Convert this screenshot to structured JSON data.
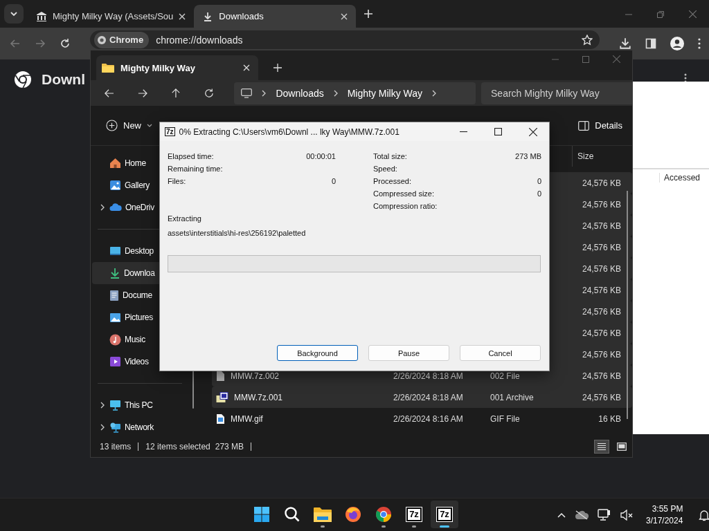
{
  "browser": {
    "tabs": [
      {
        "title": "Mighty Milky Way (Assets/Sou",
        "selected": false,
        "kind": "page"
      },
      {
        "title": "Downloads",
        "selected": true,
        "kind": "download"
      }
    ],
    "chip": "Chrome",
    "url": "chrome://downloads",
    "page_heading": "Downl"
  },
  "background_window": {
    "column_header": "Accessed"
  },
  "explorer": {
    "tab_title": "Mighty Milky Way",
    "breadcrumb": [
      "Downloads",
      "Mighty Milky Way"
    ],
    "search": {
      "placeholder": "Search Mighty Milky Way"
    },
    "new_button": "New",
    "details_button": "Details",
    "sidebar": [
      [
        {
          "label": "Home",
          "kind": "home",
          "selected": false,
          "collapsed": false
        },
        {
          "label": "Gallery",
          "kind": "gallery",
          "selected": false,
          "collapsed": false
        },
        {
          "label": "OneDriv",
          "kind": "cloud",
          "selected": false,
          "collapsed": true
        }
      ],
      [
        {
          "label": "Desktop",
          "kind": "desktop",
          "selected": false,
          "collapsed": false
        },
        {
          "label": "Downloa",
          "kind": "download",
          "selected": true,
          "collapsed": false
        },
        {
          "label": "Docume",
          "kind": "document",
          "selected": false,
          "collapsed": false
        },
        {
          "label": "Pictures",
          "kind": "pictures",
          "selected": false,
          "collapsed": false
        },
        {
          "label": "Music",
          "kind": "music",
          "selected": false,
          "collapsed": false
        },
        {
          "label": "Videos",
          "kind": "videos",
          "selected": false,
          "collapsed": false
        }
      ],
      [
        {
          "label": "This PC",
          "kind": "pc",
          "selected": false,
          "collapsed": true
        },
        {
          "label": "Network",
          "kind": "network",
          "selected": false,
          "collapsed": true
        }
      ]
    ],
    "size_column": "Size",
    "rows": [
      {
        "size": "24,576 KB",
        "selected": true
      },
      {
        "size": "24,576 KB",
        "selected": true
      },
      {
        "size": "24,576 KB",
        "selected": true
      },
      {
        "size": "24,576 KB",
        "selected": true
      },
      {
        "size": "24,576 KB",
        "selected": true
      },
      {
        "size": "24,576 KB",
        "selected": true
      },
      {
        "size": "24,576 KB",
        "selected": true
      },
      {
        "size": "24,576 KB",
        "selected": true
      },
      {
        "size": "24,576 KB",
        "selected": true
      },
      {
        "kind": "file",
        "name": "MMW.7z.002",
        "modified": "2/26/2024 8:18 AM",
        "type": "002 File",
        "size": "24,576 KB",
        "selected": true
      },
      {
        "kind": "archive",
        "name": "MMW.7z.001",
        "modified": "2/26/2024 8:18 AM",
        "type": "001 Archive",
        "size": "24,576 KB",
        "selected": true
      },
      {
        "kind": "image",
        "name": "MMW.gif",
        "modified": "2/26/2024 8:16 AM",
        "type": "GIF File",
        "size": "16 KB",
        "selected": false
      }
    ],
    "status": {
      "items": "13 items",
      "selected": "12 items selected",
      "size": "273 MB"
    },
    "view_buttons": [
      {
        "kind": "details",
        "selected": true
      },
      {
        "kind": "tiles",
        "selected": false
      }
    ]
  },
  "dialog": {
    "icon_label": "7z",
    "title": "0% Extracting C:\\Users\\vm6\\Downl ... lky Way\\MMW.7z.001",
    "left_stats": [
      {
        "label": "Elapsed time:",
        "value": "00:00:01"
      },
      {
        "label": "Remaining time:"
      },
      {
        "label": "Files:",
        "value": "0"
      }
    ],
    "right_stats": [
      {
        "label": "Total size:",
        "value": "273 MB"
      },
      {
        "label": "Speed:"
      },
      {
        "label": "Processed:",
        "value": "0"
      },
      {
        "label": "Compressed size:",
        "value": "0"
      },
      {
        "label": "Compression ratio:"
      }
    ],
    "action_label": "Extracting",
    "current_path": "assets\\interstitials\\hi-res\\256192\\paletted",
    "progress": {
      "level": 0
    },
    "buttons": [
      {
        "label": "Background",
        "focused": true
      },
      {
        "label": "Pause",
        "focused": false
      },
      {
        "label": "Cancel",
        "focused": false
      }
    ]
  },
  "taskbar": {
    "apps": [
      {
        "kind": "start",
        "running": false,
        "selected": false
      },
      {
        "kind": "search",
        "running": false,
        "selected": false
      },
      {
        "kind": "explorer",
        "running": true,
        "selected": false
      },
      {
        "kind": "firefox",
        "running": false,
        "selected": false
      },
      {
        "kind": "chrome",
        "running": true,
        "selected": false
      },
      {
        "kind": "sevenzip",
        "label": "7z",
        "running": true,
        "selected": false
      },
      {
        "kind": "sevenzip",
        "label": "7z",
        "running": true,
        "selected": true
      }
    ],
    "time": "3:55 PM",
    "date": "3/17/2024"
  }
}
